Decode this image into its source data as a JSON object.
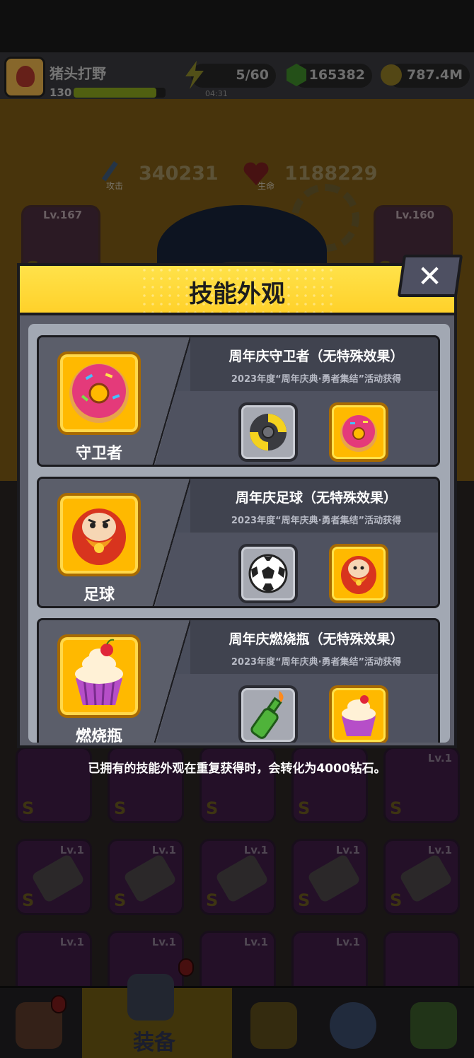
{
  "player": {
    "name": "猪头打野",
    "level": "130",
    "xp_fraction": 0.9
  },
  "resources": {
    "energy": {
      "value": "5/60",
      "timer": "04:31",
      "icon": "lightning-icon"
    },
    "gems": {
      "value": "165382",
      "icon": "green-gem-icon"
    },
    "coins": {
      "value": "787.4M",
      "icon": "gold-coin-icon"
    }
  },
  "stats": {
    "attack": {
      "label": "攻击",
      "value": "340231"
    },
    "hp": {
      "label": "生命",
      "value": "1188229"
    }
  },
  "equipment_top": [
    {
      "level": "Lv.167",
      "grade": "S"
    },
    {
      "level": "Lv.160",
      "grade": "S"
    }
  ],
  "modal": {
    "title": "技能外观",
    "close_label": "✕",
    "skins": [
      {
        "name": "守卫者",
        "title": "周年庆守卫者（无特殊效果）",
        "source": "2023年度“周年庆典·勇者集结”活动获得",
        "icon": "donut-icon",
        "base_icon": "shuriken-icon"
      },
      {
        "name": "足球",
        "title": "周年庆足球（无特殊效果）",
        "source": "2023年度“周年庆典·勇者集结”活动获得",
        "icon": "daruma-icon",
        "base_icon": "soccer-ball-icon"
      },
      {
        "name": "燃烧瓶",
        "title": "周年庆燃烧瓶（无特殊效果）",
        "source": "2023年度“周年庆典·勇者集结”活动获得",
        "icon": "cupcake-icon",
        "base_icon": "molotov-icon"
      }
    ]
  },
  "hint": "已拥有的技能外观在重复获得时，会转化为4000钻石。",
  "inventory_levels": [
    "Lv.1",
    "Lv.1",
    "Lv.1",
    "Lv.1",
    "Lv.1",
    "Lv.1",
    "Lv.1",
    "Lv.1",
    "Lv.1",
    "Lv.1"
  ],
  "inventory_grade": "S",
  "bottom_nav": {
    "equip_label": "装备"
  },
  "colors": {
    "header_yellow": "#ffd12a",
    "icon_gold": "#ffb900",
    "panel_gray": "#5a5c68"
  }
}
